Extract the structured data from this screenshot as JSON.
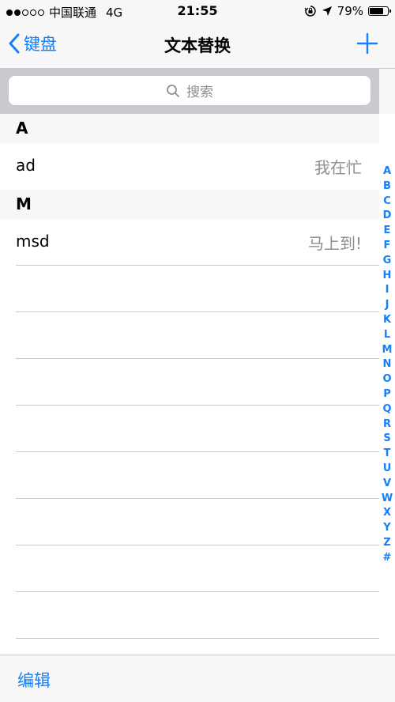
{
  "status_bar": {
    "carrier": "中国联通",
    "network": "4G",
    "time": "21:55",
    "battery": "79%",
    "battery_level": 0.79,
    "signal_dots_filled": 2,
    "signal_dots_total": 5,
    "icons": [
      "orientation-lock-icon",
      "location-arrow-icon",
      "battery-icon"
    ]
  },
  "nav": {
    "back_label": "键盘",
    "title": "文本替换",
    "add_icon": "plus-icon"
  },
  "search": {
    "placeholder": "搜索",
    "icon": "magnifier-icon"
  },
  "sections": [
    {
      "letter": "A",
      "rows": [
        {
          "phrase": "ad",
          "shortcut": "我在忙"
        }
      ]
    },
    {
      "letter": "M",
      "rows": [
        {
          "phrase": "msd",
          "shortcut": "马上到!"
        }
      ]
    }
  ],
  "index_letters": [
    "A",
    "B",
    "C",
    "D",
    "E",
    "F",
    "G",
    "H",
    "I",
    "J",
    "K",
    "L",
    "M",
    "N",
    "O",
    "P",
    "Q",
    "R",
    "S",
    "T",
    "U",
    "V",
    "W",
    "X",
    "Y",
    "Z",
    "#"
  ],
  "toolbar": {
    "edit_label": "编辑"
  },
  "colors": {
    "accent": "#157efb",
    "secondary_text": "#8e8e93",
    "separator": "#c8c7cc",
    "search_bar_bg": "#c9c9ce"
  }
}
